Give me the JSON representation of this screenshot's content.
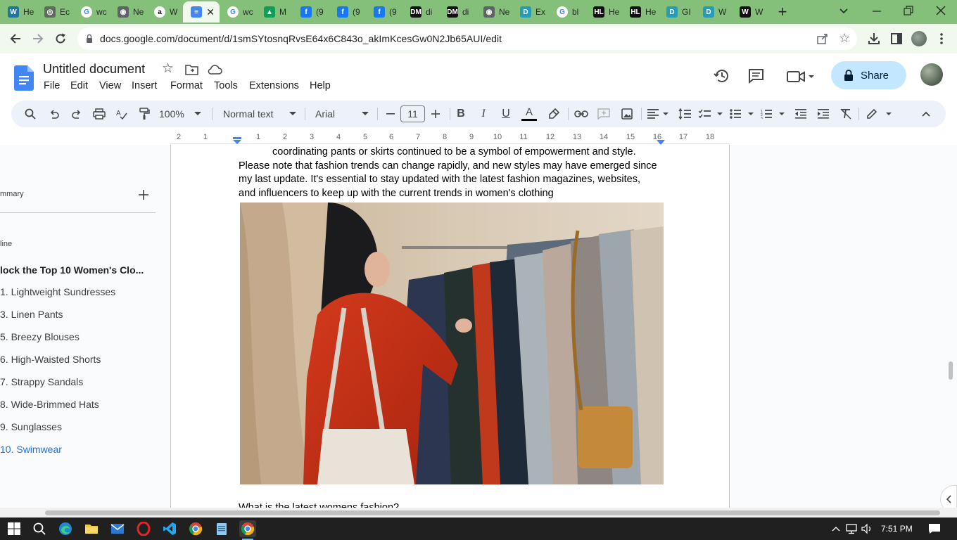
{
  "browser": {
    "tabs": [
      {
        "label": "He",
        "icon": "wordpress-icon",
        "color": "#21759b"
      },
      {
        "label": "Ec",
        "icon": "openai-icon",
        "color": "#5f6b5c"
      },
      {
        "label": "wc",
        "icon": "google-icon",
        "color": "#ffffff"
      },
      {
        "label": "Ne",
        "icon": "chrome-icon",
        "color": "#5f6368"
      },
      {
        "label": "W",
        "icon": "amazon-icon",
        "color": "#ffffff"
      },
      {
        "label": "",
        "icon": "google-docs-icon",
        "color": "#4285f4"
      },
      {
        "label": "wc",
        "icon": "google-icon",
        "color": "#ffffff"
      },
      {
        "label": "M",
        "icon": "google-drive-icon",
        "color": "#0f9d58"
      },
      {
        "label": "(9",
        "icon": "facebook-icon",
        "color": "#1877f2"
      },
      {
        "label": "(9",
        "icon": "facebook-icon",
        "color": "#1877f2"
      },
      {
        "label": "(9",
        "icon": "facebook-icon",
        "color": "#1877f2"
      },
      {
        "label": "di",
        "icon": "dm-icon",
        "color": "#111111"
      },
      {
        "label": "di",
        "icon": "dm-icon",
        "color": "#111111"
      },
      {
        "label": "Ne",
        "icon": "chrome-icon",
        "color": "#5f6368"
      },
      {
        "label": "Ex",
        "icon": "d-icon",
        "color": "#2a9bb0"
      },
      {
        "label": "bl",
        "icon": "google-icon",
        "color": "#ffffff"
      },
      {
        "label": "He",
        "icon": "hl-icon",
        "color": "#111111"
      },
      {
        "label": "He",
        "icon": "hl-icon",
        "color": "#111111"
      },
      {
        "label": "GI",
        "icon": "d-icon",
        "color": "#2a9bb0"
      },
      {
        "label": "W",
        "icon": "d-icon",
        "color": "#2a9bb0"
      },
      {
        "label": "W",
        "icon": "w-icon",
        "color": "#111111"
      }
    ],
    "active_tab_index": 5,
    "url": "docs.google.com/document/d/1smSYtosnqRvsE64x6C843o_akImKcesGw0N2Jb65AUI/edit"
  },
  "doc": {
    "title": "Untitled document",
    "menus": [
      "File",
      "Edit",
      "View",
      "Insert",
      "Format",
      "Tools",
      "Extensions",
      "Help"
    ],
    "share_label": "Share",
    "toolbar": {
      "zoom": "100%",
      "style": "Normal text",
      "font": "Arial",
      "font_size": "11"
    },
    "ruler_numbers": [
      "2",
      "1",
      "1",
      "2",
      "3",
      "4",
      "5",
      "6",
      "7",
      "8",
      "9",
      "10",
      "11",
      "12",
      "13",
      "14",
      "15",
      "16",
      "17",
      "18"
    ],
    "body_lines": [
      "coordinating pants or skirts continued to be a symbol of empowerment and style.",
      "Please note that fashion trends can change rapidly, and new styles may have emerged since",
      "my last update. It's essential to stay updated with the latest fashion magazines, websites,",
      "and influencers to keep up with the current trends in women's clothing"
    ],
    "footer_line": "What is the latest womens fashion?"
  },
  "outline": {
    "summary_label": "mmary",
    "outline_label": "line",
    "items": [
      {
        "label": "lock the Top 10 Women's Clo...",
        "bold": true
      },
      {
        "label": "1. Lightweight Sundresses"
      },
      {
        "label": "3. Linen Pants"
      },
      {
        "label": "5. Breezy Blouses"
      },
      {
        "label": "6. High-Waisted Shorts"
      },
      {
        "label": "7. Strappy Sandals"
      },
      {
        "label": "8. Wide-Brimmed Hats"
      },
      {
        "label": "9. Sunglasses"
      },
      {
        "label": "10. Swimwear",
        "active": true
      }
    ]
  },
  "taskbar": {
    "time": "7:51 PM"
  }
}
